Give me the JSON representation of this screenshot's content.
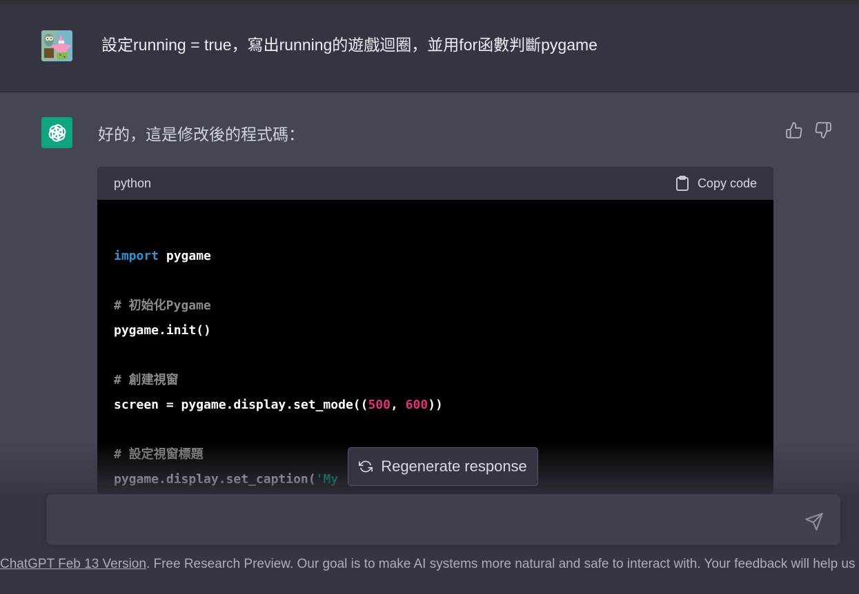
{
  "user": {
    "message": "設定running = true，寫出running的遊戲迴圈，並用for函數判斷pygame",
    "avatar_icon": "spongebob-patrick-avatar-icon"
  },
  "assistant": {
    "intro": "好的，這是修改後的程式碼：",
    "logo_icon": "openai-logo-icon"
  },
  "code_block": {
    "language": "python",
    "copy_label": "Copy code",
    "lines": [
      {
        "kw": "import",
        "rest": " pygame"
      },
      {
        "text": ""
      },
      {
        "comment": "# 初始化Pygame"
      },
      {
        "text": "pygame.init()"
      },
      {
        "text": ""
      },
      {
        "comment": "# 創建視窗"
      },
      {
        "pre": "screen = pygame.display.set_mode((",
        "n1": "500",
        "sep": ", ",
        "n2": "600",
        "post": "))"
      },
      {
        "text": ""
      },
      {
        "comment": "# 設定視窗標題"
      },
      {
        "pre": "pygame.display.set_caption(",
        "str": "'My"
      }
    ]
  },
  "regenerate": {
    "label": "Regenerate response"
  },
  "input": {
    "placeholder": ""
  },
  "footer": {
    "link_text": "ChatGPT Feb 13 Version",
    "text": ". Free Research Preview. Our goal is to make AI systems more natural and safe to interact with. Your feedback will help us improve."
  },
  "colors": {
    "background": "#444654",
    "user_row": "#343541",
    "accent": "#10a37f",
    "code_bg": "#000000",
    "keyword": "#2e95d3",
    "number": "#df3079",
    "string": "#00a67d"
  }
}
